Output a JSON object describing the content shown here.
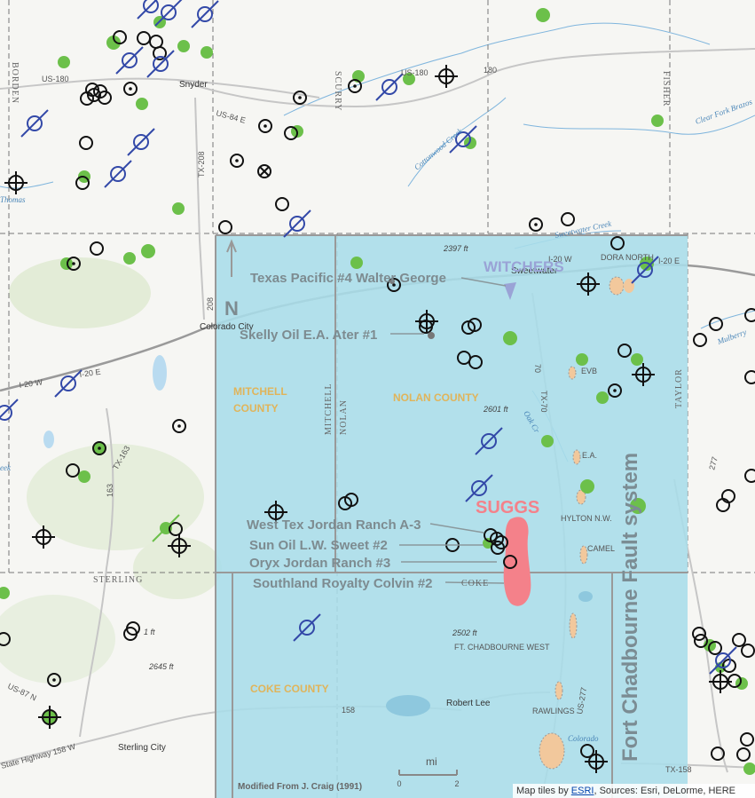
{
  "basemap": {
    "towns": [
      "Snyder",
      "Colorado City",
      "Sweetwater",
      "Robert Lee",
      "Sterling City"
    ],
    "highways": [
      "US-180",
      "US-84 E",
      "TX-208",
      "208",
      "I-20 W",
      "I-20 E",
      "TX-163",
      "163",
      "158",
      "US-87 N",
      "State Highway 158 W",
      "70",
      "TX-70",
      "US-277",
      "277",
      "TX-158",
      "180"
    ],
    "counties": [
      "BORDEN",
      "SCURRY",
      "FISHER",
      "MITCHELL",
      "NOLAN",
      "TAYLOR",
      "STERLING",
      "COKE"
    ],
    "water": [
      "Cottonwood Creek",
      "Clear Fork Brazos",
      "Sweetwater Creek",
      "Mulberry",
      "Oak Cr",
      "Colorado",
      "Thomas",
      "eek"
    ],
    "elevations": [
      "2397 ft",
      "2601 ft",
      "2502 ft",
      "2645 ft",
      "1 ft"
    ]
  },
  "overlay": {
    "well_labels": [
      "Texas Pacific #4 Walter George",
      "Skelly Oil E.A. Ater #1",
      "West Tex Jordan Ranch A-3",
      "Sun Oil L.W. Sweet #2",
      "Oryx Jordan Ranch #3",
      "Southland Royalty Colvin #2"
    ],
    "fields": {
      "witchers": "WITCHERS",
      "suggs": "SUGGS",
      "dora_north": "DORA NORTH",
      "evb": "EVB",
      "ea": "E.A.",
      "hylton_nw": "HYLTON N.W.",
      "camel": "CAMEL",
      "ft_chadbourne_west": "FT. CHADBOURNE WEST",
      "rawlings": "RAWLINGS"
    },
    "county_labels": [
      "MITCHELL",
      "COUNTY",
      "NOLAN COUNTY",
      "COKE COUNTY"
    ],
    "fault_system": "Fort Chadbourne Fault system",
    "north_arrow": "N",
    "scale_unit": "mi",
    "scale_ticks": [
      "0",
      "2"
    ],
    "credit": "Modified From J. Craig (1991)",
    "colors": {
      "overlay_fill": "#a9dde9",
      "suggs": "#f4818a",
      "witchers": "#9aa3d6",
      "field_fill": "#f2c89c",
      "green_dot": "#6cc04a",
      "blue_symbol": "#3349a8"
    }
  },
  "attribution": {
    "prefix": "Map tiles by",
    "link": "ESRI",
    "suffix": ", Sources: Esri, DeLorme, HERE"
  }
}
